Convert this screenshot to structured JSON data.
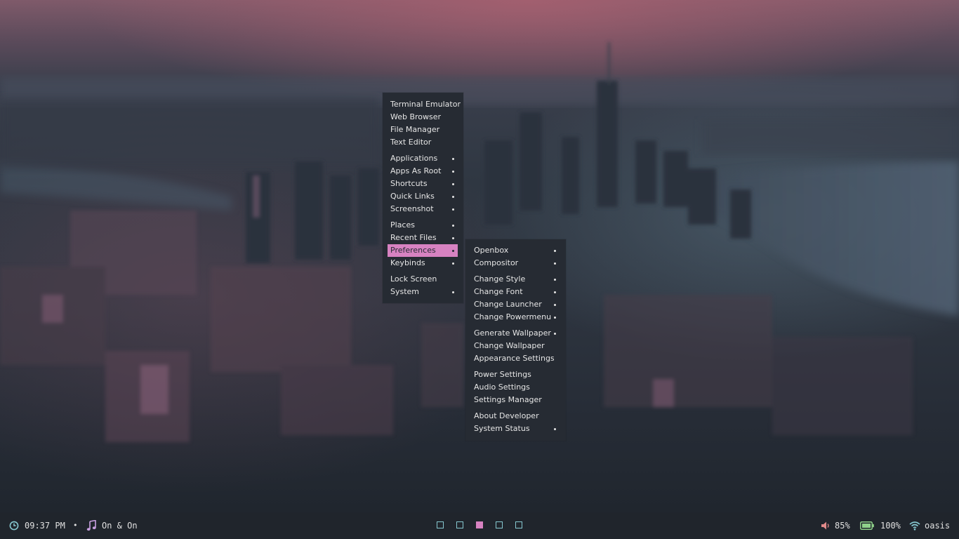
{
  "colors": {
    "menu_bg": "#262b33",
    "menu_text": "#e6e6e6",
    "accent": "#d782c1",
    "bar_bg": "#20252c",
    "workspace_outline": "#86c8d0",
    "battery": "#8fd18a"
  },
  "main_menu": {
    "items": [
      {
        "label": "Terminal Emulator"
      },
      {
        "label": "Web Browser"
      },
      {
        "label": "File Manager"
      },
      {
        "label": "Text Editor"
      },
      {
        "label": "Applications",
        "submenu": true
      },
      {
        "label": "Apps As Root",
        "submenu": true
      },
      {
        "label": "Shortcuts",
        "submenu": true
      },
      {
        "label": "Quick Links",
        "submenu": true
      },
      {
        "label": "Screenshot",
        "submenu": true
      },
      {
        "label": "Places",
        "submenu": true
      },
      {
        "label": "Recent Files",
        "submenu": true
      },
      {
        "label": "Preferences",
        "submenu": true,
        "selected": true
      },
      {
        "label": "Keybinds",
        "submenu": true
      },
      {
        "label": "Lock Screen"
      },
      {
        "label": "System",
        "submenu": true
      }
    ]
  },
  "preferences_menu": {
    "items": [
      {
        "label": "Openbox",
        "submenu": true
      },
      {
        "label": "Compositor",
        "submenu": true
      },
      {
        "label": "Change Style",
        "submenu": true
      },
      {
        "label": "Change Font",
        "submenu": true
      },
      {
        "label": "Change Launcher",
        "submenu": true
      },
      {
        "label": "Change Powermenu",
        "submenu": true
      },
      {
        "label": "Generate Wallpaper",
        "submenu": true
      },
      {
        "label": "Change Wallpaper"
      },
      {
        "label": "Appearance Settings"
      },
      {
        "label": "Power Settings"
      },
      {
        "label": "Audio Settings"
      },
      {
        "label": "Settings Manager"
      },
      {
        "label": "About Developer"
      },
      {
        "label": "System Status",
        "submenu": true
      }
    ]
  },
  "taskbar": {
    "clock": {
      "icon": "clock-icon",
      "time": "09:37 PM"
    },
    "separator": "•",
    "music": {
      "icon": "music-note-icon",
      "track": "On & On"
    },
    "workspaces": [
      {
        "active": false
      },
      {
        "active": false
      },
      {
        "active": true
      },
      {
        "active": false
      },
      {
        "active": false
      }
    ],
    "volume": {
      "icon": "volume-icon",
      "value": "85%"
    },
    "battery": {
      "icon": "battery-icon",
      "value": "100%",
      "level": 1.0
    },
    "network": {
      "icon": "wifi-icon",
      "ssid": "oasis"
    }
  }
}
